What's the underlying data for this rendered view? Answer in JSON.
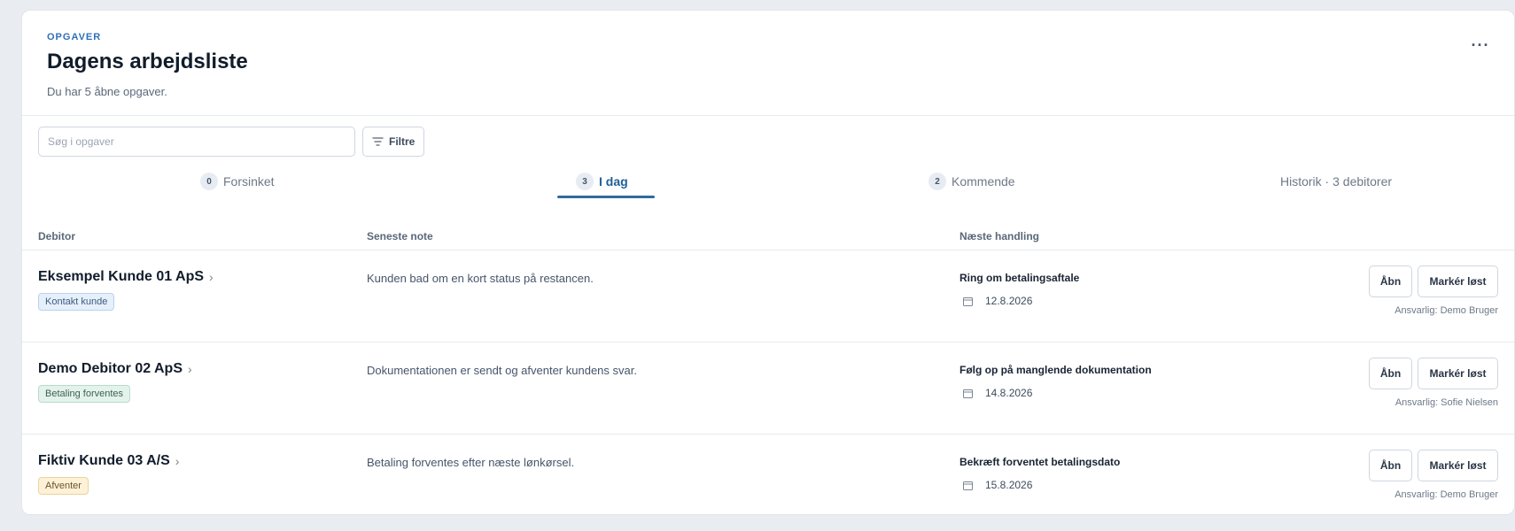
{
  "header": {
    "eyebrow": "OPGAVER",
    "title": "Dagens arbejdsliste",
    "subtitle": "Du har 5 åbne opgaver.",
    "more_label": "···"
  },
  "search": {
    "placeholder": "Søg i opgaver",
    "filter_label": "Filtre"
  },
  "tabs": [
    {
      "count": "0",
      "label": "Forsinket",
      "active": false
    },
    {
      "count": "3",
      "label": "I dag",
      "active": true
    },
    {
      "count": "2",
      "label": "Kommende",
      "active": false
    },
    {
      "count": "",
      "label": "Historik · 3 debitorer",
      "active": false
    }
  ],
  "columns": {
    "debtor": "Debitor",
    "note": "Seneste note",
    "action": "Næste handling"
  },
  "rows": [
    {
      "debtor": "Eksempel Kunde 01 ApS",
      "tag": "Kontakt kunde",
      "tag_color": "blue",
      "note": "Kunden bad om en kort status på restancen.",
      "action_title": "Ring om betalingsaftale",
      "action_date": "12.8.2026",
      "open_label": "Åbn",
      "resolve_label": "Markér løst",
      "responsible": "Ansvarlig: Demo Bruger"
    },
    {
      "debtor": "Demo Debitor 02 ApS",
      "tag": "Betaling forventes",
      "tag_color": "green",
      "note": "Dokumentationen er sendt og afventer kundens svar.",
      "action_title": "Følg op på manglende dokumentation",
      "action_date": "14.8.2026",
      "open_label": "Åbn",
      "resolve_label": "Markér løst",
      "responsible": "Ansvarlig: Sofie Nielsen"
    },
    {
      "debtor": "Fiktiv Kunde 03 A/S",
      "tag": "Afventer",
      "tag_color": "yellow",
      "note": "Betaling forventes efter næste lønkørsel.",
      "action_title": "Bekræft forventet betalingsdato",
      "action_date": "15.8.2026",
      "open_label": "Åbn",
      "resolve_label": "Markér løst",
      "responsible": "Ansvarlig: Demo Bruger"
    }
  ],
  "colors": {
    "accent": "#2f6fb8",
    "tab_active": "#1f5f96",
    "background": "#e9edf2"
  },
  "icons": {
    "more": "more-horizontal-icon",
    "filter": "filter-icon",
    "chevron": "chevron-right-icon",
    "calendar": "calendar-icon"
  }
}
